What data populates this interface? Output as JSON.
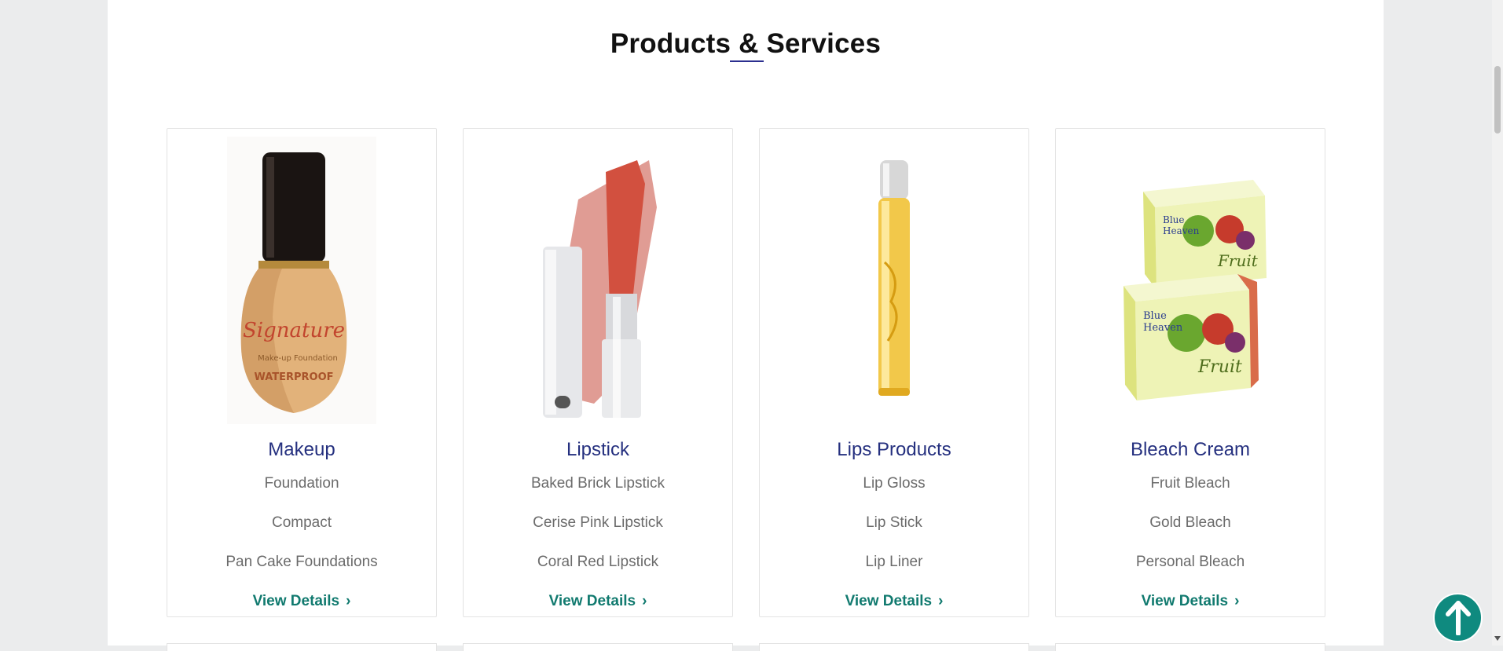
{
  "section": {
    "title": "Products & Services"
  },
  "cards": [
    {
      "title": "Makeup",
      "items": [
        "Foundation",
        "Compact",
        "Pan Cake Foundations"
      ],
      "link": "View Details",
      "image": "foundation-bottle-image"
    },
    {
      "title": "Lipstick",
      "items": [
        "Baked Brick Lipstick",
        "Cerise Pink Lipstick",
        "Coral Red Lipstick"
      ],
      "link": "View Details",
      "image": "lipstick-image"
    },
    {
      "title": "Lips Products",
      "items": [
        "Lip Gloss",
        "Lip Stick",
        "Lip Liner"
      ],
      "link": "View Details",
      "image": "lip-oil-roller-image"
    },
    {
      "title": "Bleach Cream",
      "items": [
        "Fruit Bleach",
        "Gold Bleach",
        "Personal Bleach"
      ],
      "link": "View Details",
      "image": "bleach-cream-boxes-image"
    }
  ],
  "icons": {
    "chevron": "chevron-right-icon",
    "scroll_top": "arrow-up-icon"
  },
  "colors": {
    "accent_blue": "#25307f",
    "link_teal": "#117a6f",
    "button_teal": "#0f8a7f",
    "text_gray": "#6b6b6b",
    "page_bg": "#ebeced"
  }
}
